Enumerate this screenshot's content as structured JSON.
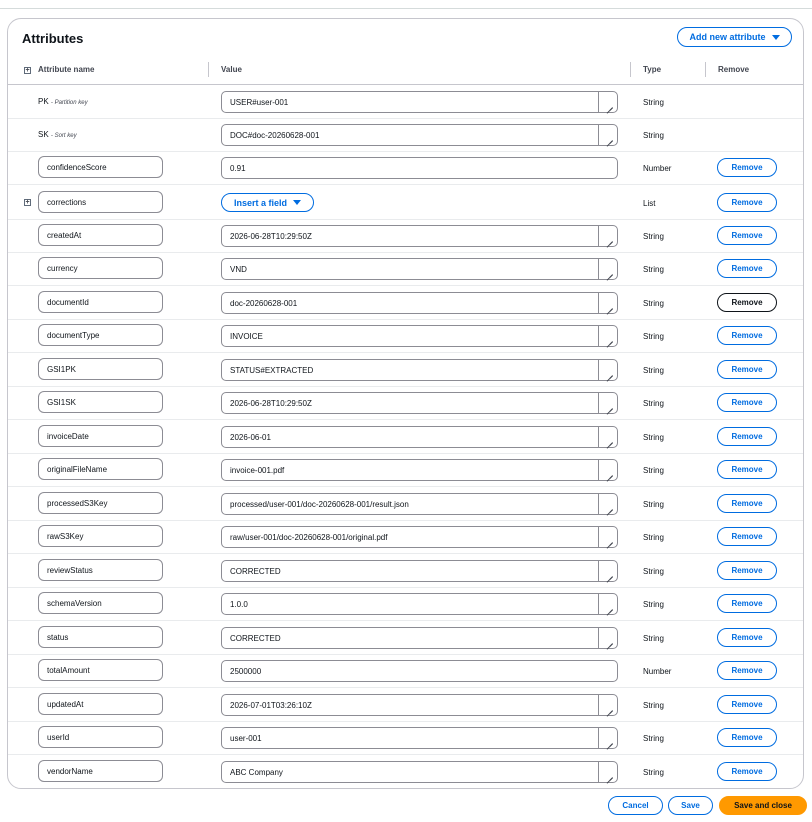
{
  "panel": {
    "title": "Attributes",
    "add_button_label": "Add new attribute"
  },
  "columns": {
    "name": "Attribute name",
    "value": "Value",
    "type": "Type",
    "remove": "Remove"
  },
  "keys": [
    {
      "name": "PK",
      "desc": "- Partition key",
      "value": "USER#user-001",
      "type": "String"
    },
    {
      "name": "SK",
      "desc": "- Sort key",
      "value": "DOC#doc-20260628-001",
      "type": "String"
    }
  ],
  "attributes": [
    {
      "name": "confidenceScore",
      "value": "0.91",
      "type": "Number",
      "remove": "Remove"
    },
    {
      "name": "corrections",
      "insert_label": "Insert a field",
      "type": "List",
      "remove": "Remove"
    },
    {
      "name": "createdAt",
      "value": "2026-06-28T10:29:50Z",
      "type": "String",
      "remove": "Remove"
    },
    {
      "name": "currency",
      "value": "VND",
      "type": "String",
      "remove": "Remove"
    },
    {
      "name": "documentId",
      "value": "doc-20260628-001",
      "type": "String",
      "remove": "Remove"
    },
    {
      "name": "documentType",
      "value": "INVOICE",
      "type": "String",
      "remove": "Remove"
    },
    {
      "name": "GSI1PK",
      "value": "STATUS#EXTRACTED",
      "type": "String",
      "remove": "Remove"
    },
    {
      "name": "GSI1SK",
      "value": "2026-06-28T10:29:50Z",
      "type": "String",
      "remove": "Remove"
    },
    {
      "name": "invoiceDate",
      "value": "2026-06-01",
      "type": "String",
      "remove": "Remove"
    },
    {
      "name": "originalFileName",
      "value": "invoice-001.pdf",
      "type": "String",
      "remove": "Remove"
    },
    {
      "name": "processedS3Key",
      "value": "processed/user-001/doc-20260628-001/result.json",
      "type": "String",
      "remove": "Remove"
    },
    {
      "name": "rawS3Key",
      "value": "raw/user-001/doc-20260628-001/original.pdf",
      "type": "String",
      "remove": "Remove"
    },
    {
      "name": "reviewStatus",
      "value": "CORRECTED",
      "type": "String",
      "remove": "Remove"
    },
    {
      "name": "schemaVersion",
      "value": "1.0.0",
      "type": "String",
      "remove": "Remove"
    },
    {
      "name": "status",
      "value": "CORRECTED",
      "type": "String",
      "remove": "Remove"
    },
    {
      "name": "totalAmount",
      "value": "2500000",
      "type": "Number",
      "remove": "Remove"
    },
    {
      "name": "updatedAt",
      "value": "2026-07-01T03:26:10Z",
      "type": "String",
      "remove": "Remove"
    },
    {
      "name": "userId",
      "value": "user-001",
      "type": "String",
      "remove": "Remove"
    },
    {
      "name": "vendorName",
      "value": "ABC Company",
      "type": "String",
      "remove": "Remove"
    }
  ],
  "footer": {
    "cancel": "Cancel",
    "save": "Save",
    "save_close": "Save and close"
  },
  "colors": {
    "accent": "#006ce0",
    "primary": "#ff9900",
    "border": "#8c8c94"
  },
  "icons": {
    "expand": "plus-square-icon",
    "dropdown": "caret-down-icon",
    "resize": "resize-handle-icon"
  }
}
